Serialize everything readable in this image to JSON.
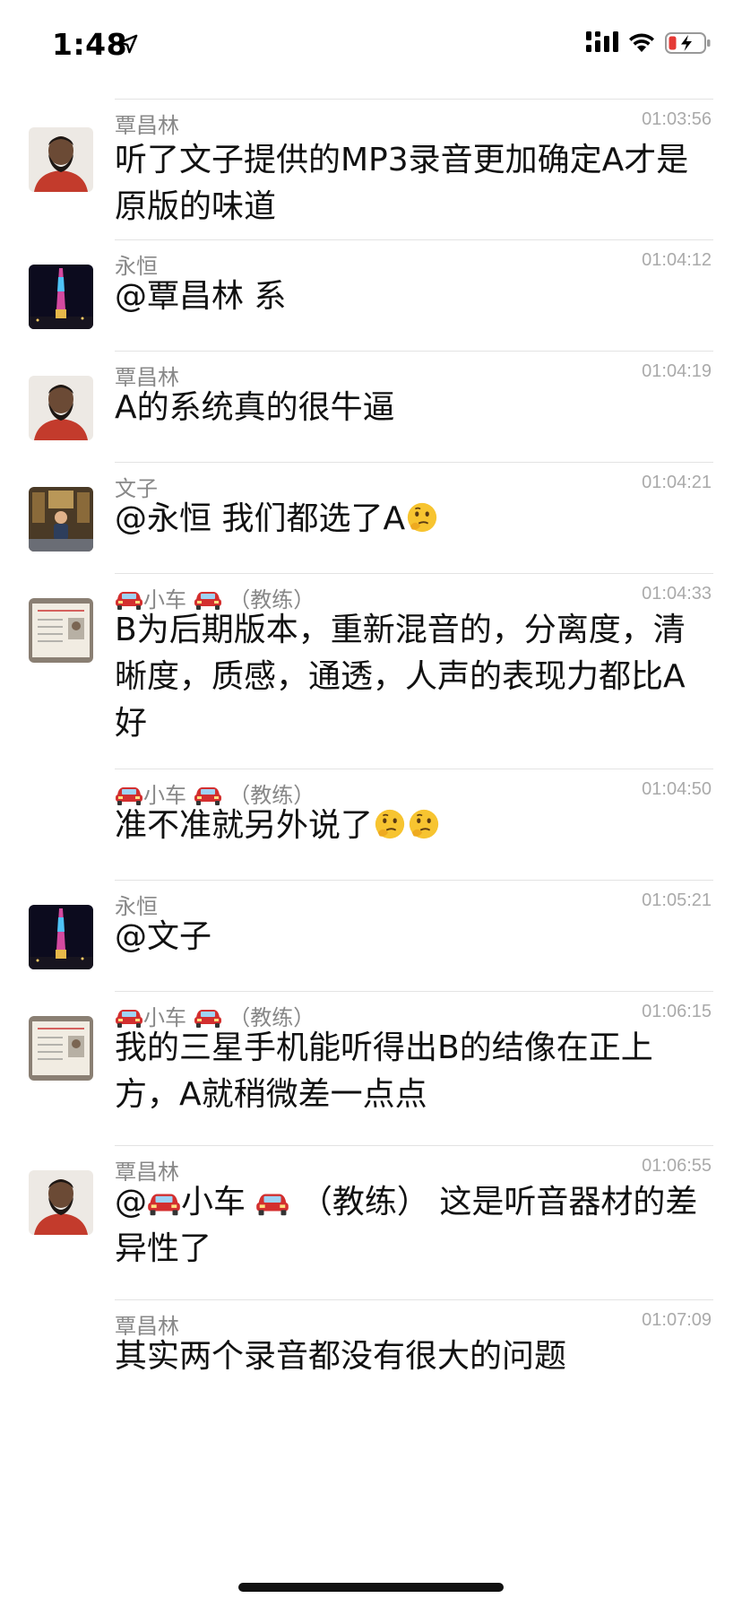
{
  "status_bar": {
    "time": "1:48"
  },
  "messages": [
    {
      "sender": "覃昌林",
      "time": "01:03:56",
      "text": "听了文子提供的MP3录音更加确定A才是原版的味道"
    },
    {
      "sender": "永恒",
      "time": "01:04:12",
      "text": "@覃昌林 系"
    },
    {
      "sender": "覃昌林",
      "time": "01:04:19",
      "text": "A的系统真的很牛逼"
    },
    {
      "sender": "文子",
      "time": "01:04:21",
      "text": "@永恒 我们都选了A"
    },
    {
      "sender": "小车",
      "sender_suffix": "（教练）",
      "time": "01:04:33",
      "text": "B为后期版本，重新混音的，分离度，清晰度，质感，通透，人声的表现力都比A好"
    },
    {
      "sender": "小车",
      "sender_suffix": "（教练）",
      "time": "01:04:50",
      "text": "准不准就另外说了"
    },
    {
      "sender": "永恒",
      "time": "01:05:21",
      "text": "@文子"
    },
    {
      "sender": "小车",
      "sender_suffix": "（教练）",
      "time": "01:06:15",
      "text": "我的三星手机能听得出B的结像在正上方，A就稍微差一点点"
    },
    {
      "sender": "覃昌林",
      "time": "01:06:55",
      "text_prefix": "@",
      "text_name": "小车",
      "text_suffix": "（教练） 这是听音器材的差异性了"
    },
    {
      "sender": "覃昌林",
      "time": "01:07:09",
      "text": "其实两个录音都没有很大的问题"
    }
  ],
  "colors": {
    "text": "#111111",
    "meta": "#888888",
    "divider": "#e3e3e3",
    "car": "#d32f2f"
  },
  "icons": [
    "location-arrow-icon",
    "signal-icon",
    "wifi-icon",
    "battery-low-charging-icon",
    "car-emoji-icon",
    "thinking-face-emoji-icon"
  ]
}
